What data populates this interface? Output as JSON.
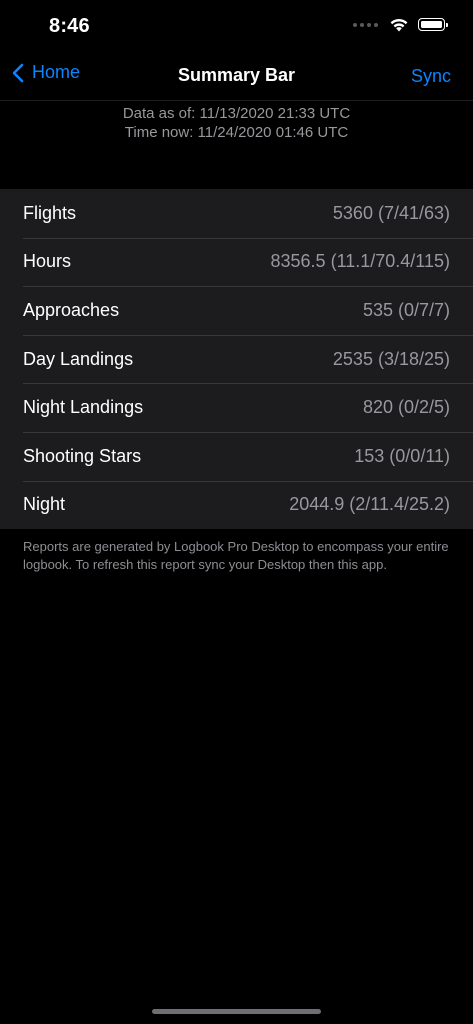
{
  "status_bar": {
    "time": "8:46"
  },
  "nav": {
    "back_label": "Home",
    "title": "Summary Bar",
    "sync_label": "Sync"
  },
  "info": {
    "data_as_of": "Data as of: 11/13/2020 21:33 UTC",
    "time_now": "Time now: 11/24/2020 01:46 UTC"
  },
  "rows": [
    {
      "label": "Flights",
      "value": "5360 (7/41/63)"
    },
    {
      "label": "Hours",
      "value": "8356.5 (11.1/70.4/115)"
    },
    {
      "label": "Approaches",
      "value": "535 (0/7/7)"
    },
    {
      "label": "Day Landings",
      "value": "2535 (3/18/25)"
    },
    {
      "label": "Night Landings",
      "value": "820 (0/2/5)"
    },
    {
      "label": "Shooting Stars",
      "value": "153 (0/0/11)"
    },
    {
      "label": "Night",
      "value": "2044.9 (2/11.4/25.2)"
    }
  ],
  "footer_note": "Reports are generated by Logbook Pro Desktop to encompass your entire logbook. To refresh this report sync your Desktop then this app.",
  "colors": {
    "accent": "#0a84ff",
    "background": "#000000",
    "cell_background": "#1c1c1e",
    "secondary_text": "#98989d"
  },
  "icons": {
    "back": "chevron-left-icon",
    "wifi": "wifi-icon",
    "battery": "battery-icon",
    "cellular": "cellular-signal-icon"
  }
}
